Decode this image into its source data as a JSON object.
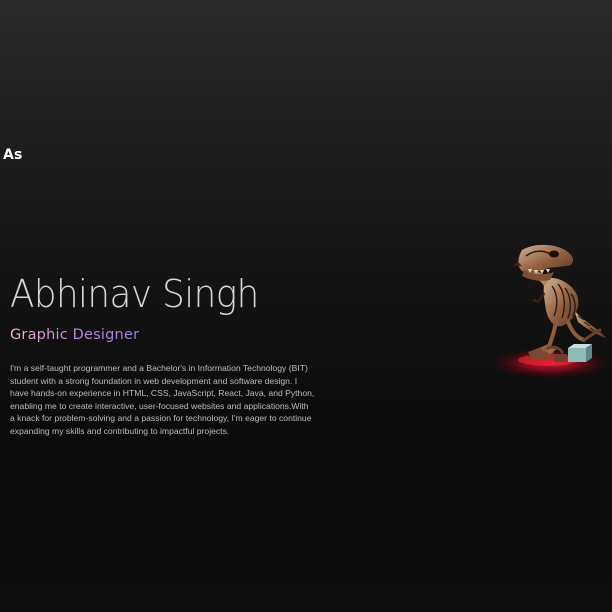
{
  "logo": {
    "text": "As"
  },
  "hero": {
    "name": "Abhinav Singh",
    "role": "Graphic Designer",
    "bio": "I'm a self-taught programmer and a Bachelor's in Information Technology (BIT) student with a strong foundation in web development and software design. I have hands-on experience in HTML, CSS, JavaScript, React, Java, and Python, enabling me to create interactive, user-focused websites and applications.With a knack for problem-solving and a passion for technology, I'm eager to continue expanding my skills and contributing to impactful projects."
  },
  "model": {
    "icon": "dinosaur-skeleton-icon",
    "colors": {
      "bone": "#8a5a3c",
      "bone_light": "#c9a58a",
      "glow": "#d4102a",
      "block": "#8fbab8"
    }
  }
}
